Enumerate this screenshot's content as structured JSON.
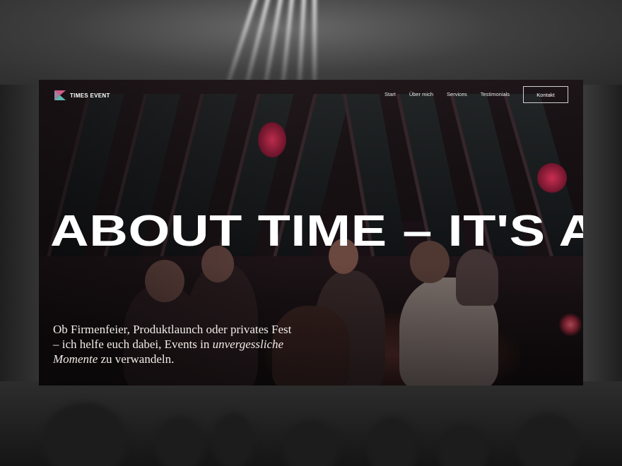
{
  "nav": {
    "logo_text": "TIMES EVENT",
    "links": [
      "Start",
      "Über mich",
      "Services",
      "Testimonials"
    ],
    "cta": "Kontakt"
  },
  "hero": {
    "headline": "ABOUT TIME – IT'S AB",
    "intro_before": "Ob Firmenfeier, Produktlaunch oder privates Fest – ich helfe euch dabei, Events in ",
    "intro_emphasis": "unvergessliche Momente",
    "intro_after": " zu verwandeln."
  },
  "colors": {
    "logo_pink": "#d45a8a",
    "logo_teal": "#5fb8b0",
    "hero_overlay": "#1a1216",
    "text": "#ffffff"
  }
}
